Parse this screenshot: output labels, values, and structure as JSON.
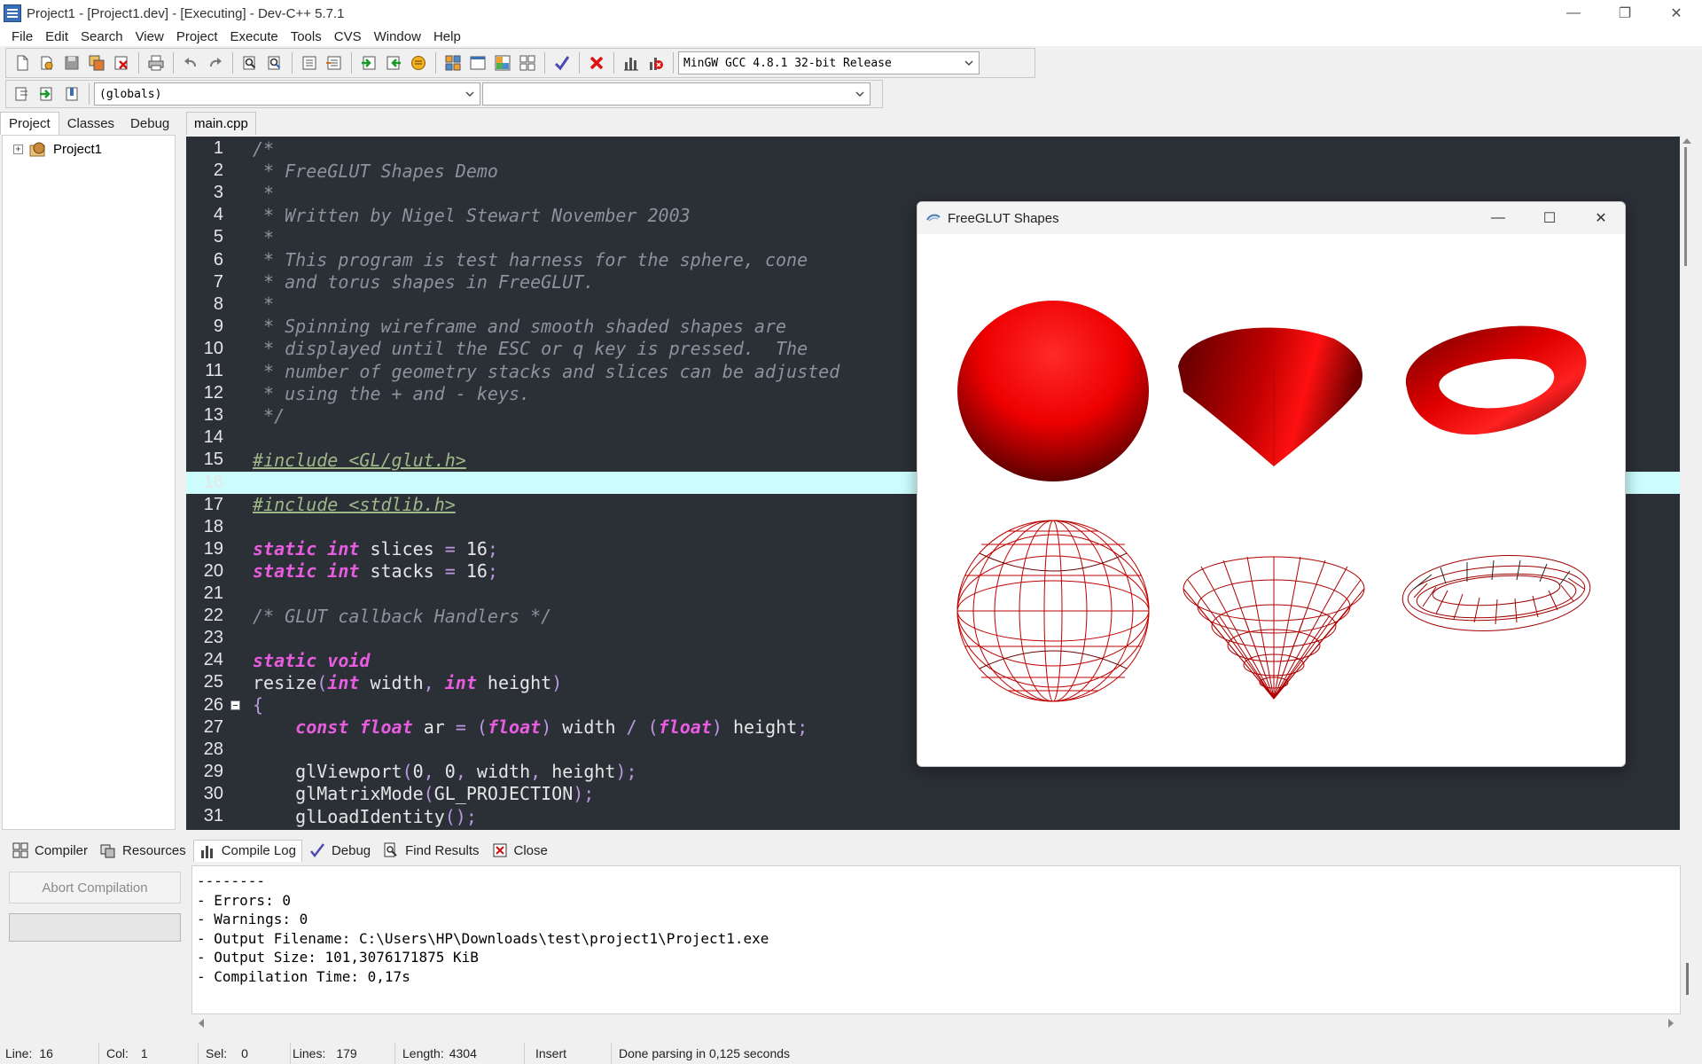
{
  "window": {
    "title": "Project1 - [Project1.dev] - [Executing] - Dev-C++ 5.7.1",
    "minimize": "—",
    "restore": "❐",
    "close": "✕"
  },
  "menu": [
    "File",
    "Edit",
    "Search",
    "View",
    "Project",
    "Execute",
    "Tools",
    "CVS",
    "Window",
    "Help"
  ],
  "toolbar": {
    "compiler_select": "MinGW GCC 4.8.1 32-bit Release",
    "class_select": "(globals)",
    "member_select": ""
  },
  "left_panel": {
    "tabs": [
      "Project",
      "Classes",
      "Debug"
    ],
    "active_tab": "Project",
    "tree": {
      "expander": "+",
      "label": "Project1"
    }
  },
  "editor": {
    "tab": "main.cpp",
    "current_line": 16,
    "lines": [
      [
        [
          "c",
          "/*"
        ]
      ],
      [
        [
          "c",
          " * FreeGLUT Shapes Demo"
        ]
      ],
      [
        [
          "c",
          " *"
        ]
      ],
      [
        [
          "c",
          " * Written by Nigel Stewart November 2003"
        ]
      ],
      [
        [
          "c",
          " *"
        ]
      ],
      [
        [
          "c",
          " * This program is test harness for the sphere, cone"
        ]
      ],
      [
        [
          "c",
          " * and torus shapes in FreeGLUT."
        ]
      ],
      [
        [
          "c",
          " *"
        ]
      ],
      [
        [
          "c",
          " * Spinning wireframe and smooth shaded shapes are"
        ]
      ],
      [
        [
          "c",
          " * displayed until the ESC or q key is pressed.  The"
        ]
      ],
      [
        [
          "c",
          " * number of geometry stacks and slices can be adjusted"
        ]
      ],
      [
        [
          "c",
          " * using the + and - keys."
        ]
      ],
      [
        [
          "c",
          " */"
        ]
      ],
      [],
      [
        [
          "p",
          "#include <GL/glut.h>"
        ]
      ],
      [],
      [
        [
          "p",
          "#include <stdlib.h>"
        ]
      ],
      [],
      [
        [
          "k",
          "static"
        ],
        [
          "i",
          " "
        ],
        [
          "k",
          "int"
        ],
        [
          "i",
          " slices "
        ],
        [
          "s",
          "="
        ],
        [
          "i",
          " 16"
        ],
        [
          "s",
          ";"
        ]
      ],
      [
        [
          "k",
          "static"
        ],
        [
          "i",
          " "
        ],
        [
          "k",
          "int"
        ],
        [
          "i",
          " stacks "
        ],
        [
          "s",
          "="
        ],
        [
          "i",
          " 16"
        ],
        [
          "s",
          ";"
        ]
      ],
      [],
      [
        [
          "c",
          "/* GLUT callback Handlers */"
        ]
      ],
      [],
      [
        [
          "k",
          "static"
        ],
        [
          "i",
          " "
        ],
        [
          "k",
          "void"
        ]
      ],
      [
        [
          "i",
          "resize"
        ],
        [
          "s",
          "("
        ],
        [
          "k",
          "int"
        ],
        [
          "i",
          " width"
        ],
        [
          "s",
          ","
        ],
        [
          "i",
          " "
        ],
        [
          "k",
          "int"
        ],
        [
          "i",
          " height"
        ],
        [
          "s",
          ")"
        ]
      ],
      [
        [
          "s",
          "{"
        ]
      ],
      [
        [
          "i",
          "    "
        ],
        [
          "k",
          "const"
        ],
        [
          "i",
          " "
        ],
        [
          "k",
          "float"
        ],
        [
          "i",
          " ar "
        ],
        [
          "s",
          "="
        ],
        [
          "i",
          " "
        ],
        [
          "s",
          "("
        ],
        [
          "k",
          "float"
        ],
        [
          "s",
          ")"
        ],
        [
          "i",
          " width "
        ],
        [
          "s",
          "/"
        ],
        [
          "i",
          " "
        ],
        [
          "s",
          "("
        ],
        [
          "k",
          "float"
        ],
        [
          "s",
          ")"
        ],
        [
          "i",
          " height"
        ],
        [
          "s",
          ";"
        ]
      ],
      [],
      [
        [
          "i",
          "    glViewport"
        ],
        [
          "s",
          "("
        ],
        [
          "i",
          "0"
        ],
        [
          "s",
          ","
        ],
        [
          "i",
          " 0"
        ],
        [
          "s",
          ","
        ],
        [
          "i",
          " width"
        ],
        [
          "s",
          ","
        ],
        [
          "i",
          " height"
        ],
        [
          "s",
          ");"
        ]
      ],
      [
        [
          "i",
          "    glMatrixMode"
        ],
        [
          "s",
          "("
        ],
        [
          "i",
          "GL_PROJECTION"
        ],
        [
          "s",
          ");"
        ]
      ],
      [
        [
          "i",
          "    glLoadIdentity"
        ],
        [
          "s",
          "();"
        ]
      ]
    ]
  },
  "glut_window": {
    "title": "FreeGLUT Shapes",
    "minimize": "—",
    "maximize": "☐",
    "close": "✕",
    "shapes": [
      "solid-sphere",
      "solid-cone",
      "solid-torus",
      "wire-sphere",
      "wire-cone",
      "wire-torus"
    ],
    "shape_color": "#ff0000"
  },
  "bottom": {
    "tabs": [
      "Compiler",
      "Resources",
      "Compile Log",
      "Debug",
      "Find Results",
      "Close"
    ],
    "active_tab": "Compile Log",
    "abort_button": "Abort Compilation",
    "log": [
      "--------",
      "- Errors: 0",
      "- Warnings: 0",
      "- Output Filename: C:\\Users\\HP\\Downloads\\test\\project1\\Project1.exe",
      "- Output Size: 101,3076171875 KiB",
      "- Compilation Time: 0,17s"
    ]
  },
  "status": {
    "line_label": "Line:",
    "line": "16",
    "col_label": "Col:",
    "col": "1",
    "sel_label": "Sel:",
    "sel": "0",
    "lines_label": "Lines:",
    "lines": "179",
    "length_label": "Length:",
    "length": "4304",
    "mode": "Insert",
    "message": "Done parsing in 0,125 seconds"
  },
  "colors": {
    "editor_bg": "#2b2f36",
    "current_line": "#ccfcfc",
    "comment": "#8d929c",
    "preprocessor": "#9fb88a",
    "keyword": "#e85ce0",
    "symbol": "#bb98e0"
  }
}
